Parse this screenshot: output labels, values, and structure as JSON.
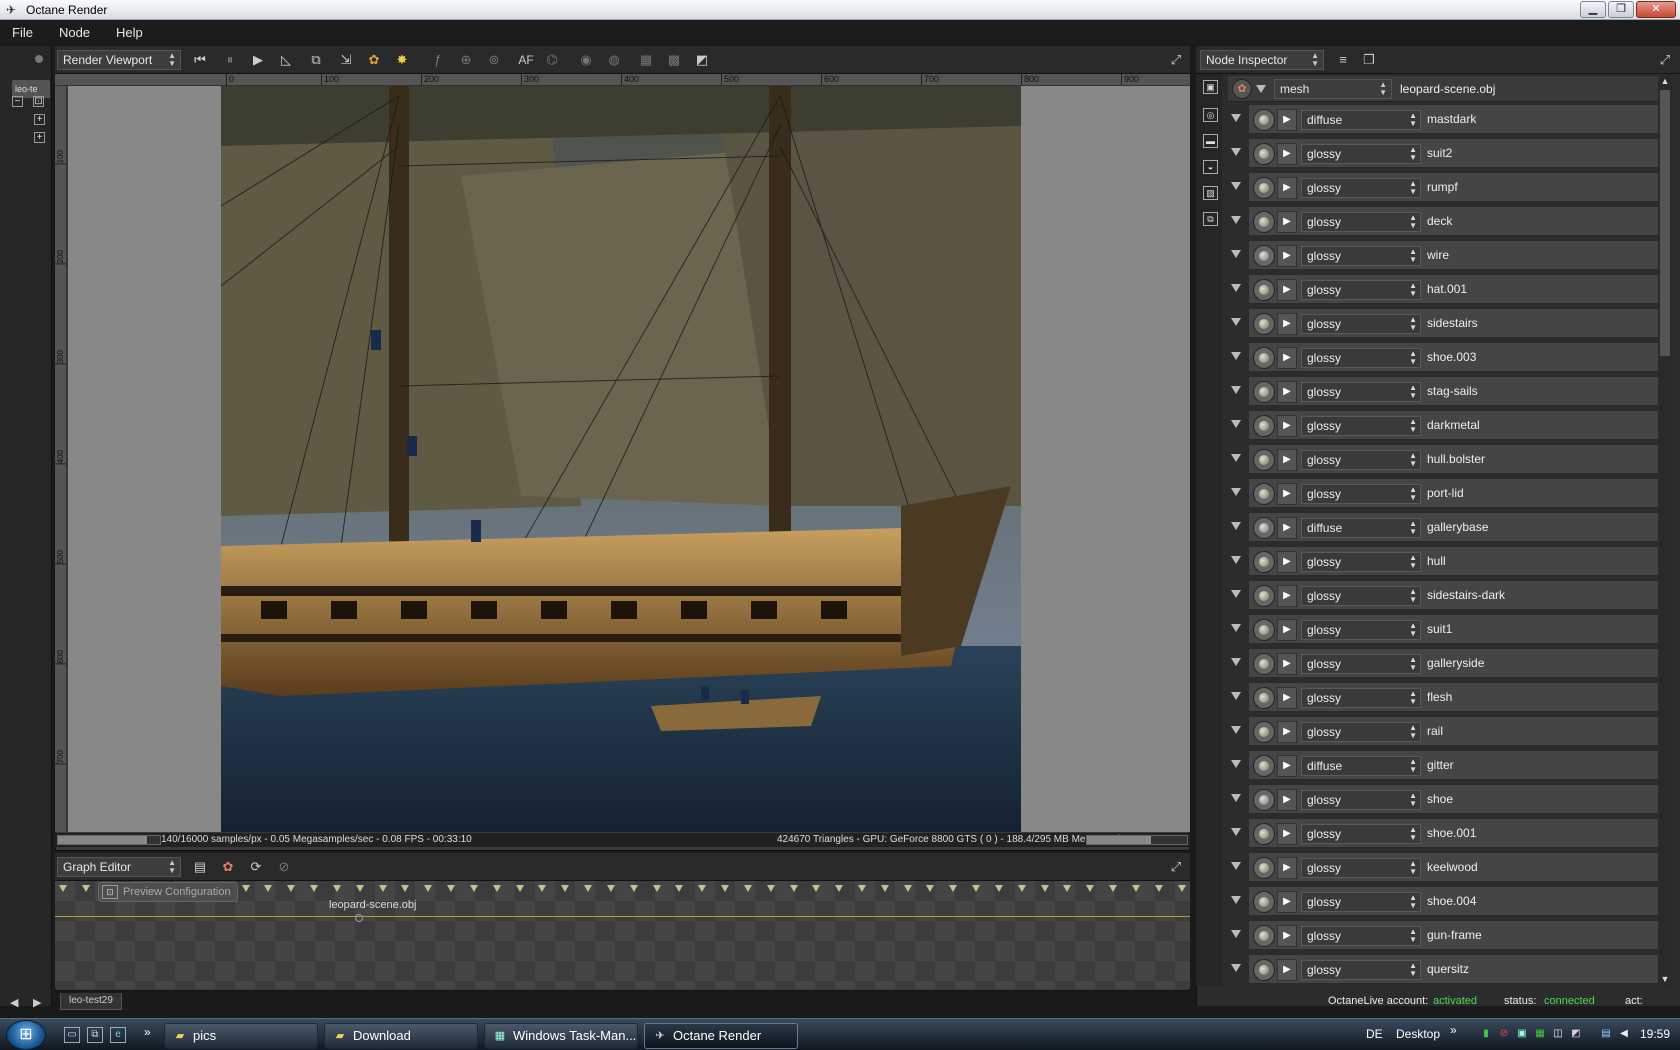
{
  "window": {
    "title": "Octane Render"
  },
  "menu": [
    "File",
    "Node",
    "Help"
  ],
  "left_tab": "leo-te",
  "viewport": {
    "selector": "Render Viewport",
    "toolbar_text": "AF",
    "ruler_h": [
      "0",
      "100",
      "200",
      "300",
      "400",
      "500",
      "600",
      "700",
      "800",
      "900"
    ],
    "ruler_v": [
      "100",
      "200",
      "300",
      "400",
      "500",
      "600",
      "700"
    ],
    "status_left": "140/16000 samples/px - 0.05 Megasamples/sec - 0.08 FPS - 00:33:10",
    "status_right": "424670 Triangles - GPU: GeForce 8800 GTS ( 0 ) - 188.4/295 MB Mem Used",
    "render_progress": 0.875,
    "mem_progress": 0.64
  },
  "graph": {
    "selector": "Graph Editor",
    "node_chip": "Preview Configuration",
    "node_label": "leopard-scene.obj",
    "tab": "leo-test29"
  },
  "inspector": {
    "selector": "Node Inspector",
    "mesh_type": "mesh",
    "mesh_name": "leopard-scene.obj",
    "materials": [
      {
        "type": "diffuse",
        "name": "mastdark"
      },
      {
        "type": "glossy",
        "name": "suit2"
      },
      {
        "type": "glossy",
        "name": "rumpf"
      },
      {
        "type": "glossy",
        "name": "deck"
      },
      {
        "type": "glossy",
        "name": "wire"
      },
      {
        "type": "glossy",
        "name": "hat.001"
      },
      {
        "type": "glossy",
        "name": "sidestairs"
      },
      {
        "type": "glossy",
        "name": "shoe.003"
      },
      {
        "type": "glossy",
        "name": "stag-sails"
      },
      {
        "type": "glossy",
        "name": "darkmetal"
      },
      {
        "type": "glossy",
        "name": "hull.bolster"
      },
      {
        "type": "glossy",
        "name": "port-lid"
      },
      {
        "type": "diffuse",
        "name": "gallerybase"
      },
      {
        "type": "glossy",
        "name": "hull"
      },
      {
        "type": "glossy",
        "name": "sidestairs-dark"
      },
      {
        "type": "glossy",
        "name": "suit1"
      },
      {
        "type": "glossy",
        "name": "galleryside"
      },
      {
        "type": "glossy",
        "name": "flesh"
      },
      {
        "type": "glossy",
        "name": "rail"
      },
      {
        "type": "diffuse",
        "name": "gitter"
      },
      {
        "type": "glossy",
        "name": "shoe"
      },
      {
        "type": "glossy",
        "name": "shoe.001"
      },
      {
        "type": "glossy",
        "name": "keelwood"
      },
      {
        "type": "glossy",
        "name": "shoe.004"
      },
      {
        "type": "glossy",
        "name": "gun-frame"
      },
      {
        "type": "glossy",
        "name": "quersitz"
      }
    ],
    "status": {
      "account_label": "OctaneLive account:",
      "account_value": "activated",
      "status_label": "status:",
      "status_value": "connected",
      "act_label": "act:"
    }
  },
  "taskbar": {
    "chevron": "»",
    "buttons": [
      "pics",
      "Download",
      "Windows Task-Man...",
      "Octane Render"
    ],
    "lang": "DE",
    "desktop": "Desktop",
    "tray_chevron": "»",
    "clock": "19:59"
  },
  "colors": {
    "accent_green": "#50d650",
    "panel": "#2c2c2c"
  }
}
